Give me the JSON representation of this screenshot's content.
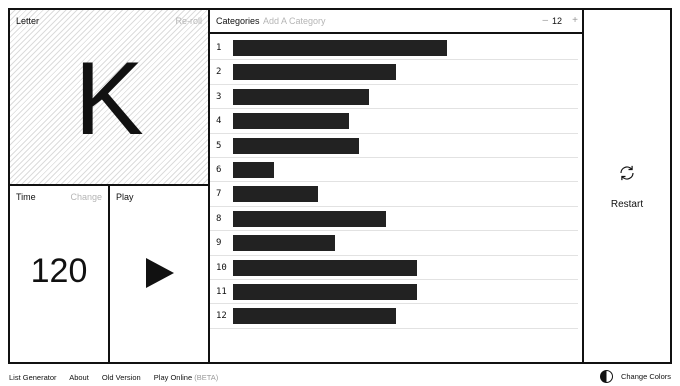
{
  "letter_panel": {
    "label": "Letter",
    "reroll": "Re-roll",
    "letter": "K"
  },
  "time_panel": {
    "label": "Time",
    "change": "Change",
    "seconds": "120"
  },
  "play_panel": {
    "label": "Play"
  },
  "categories_panel": {
    "label": "Categories",
    "add_placeholder": "Add A Category",
    "minus": "–",
    "count": "12",
    "plus": "+",
    "rows": [
      {
        "num": "1",
        "fill": 0.63
      },
      {
        "num": "2",
        "fill": 0.48
      },
      {
        "num": "3",
        "fill": 0.4
      },
      {
        "num": "4",
        "fill": 0.34
      },
      {
        "num": "5",
        "fill": 0.37
      },
      {
        "num": "6",
        "fill": 0.12
      },
      {
        "num": "7",
        "fill": 0.25
      },
      {
        "num": "8",
        "fill": 0.45
      },
      {
        "num": "9",
        "fill": 0.3
      },
      {
        "num": "10",
        "fill": 0.54
      },
      {
        "num": "11",
        "fill": 0.54
      },
      {
        "num": "12",
        "fill": 0.48
      }
    ]
  },
  "restart_panel": {
    "label": "Restart",
    "icon": "refresh-icon"
  },
  "footer": {
    "links": [
      "List Generator",
      "About",
      "Old Version",
      "Play Online"
    ],
    "beta": "(BETA)",
    "change_colors": "Change Colors",
    "change_colors_icon": "half-circle-contrast-icon"
  }
}
